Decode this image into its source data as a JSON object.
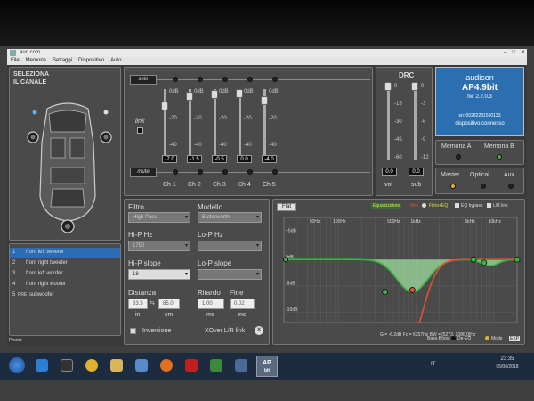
{
  "window": {
    "title": "aud.com"
  },
  "menu": [
    "File",
    "Memorie",
    "Settaggi",
    "Dispositivo",
    "Auto"
  ],
  "left": {
    "title_line1": "SELEZIONA",
    "title_line2": "IL CANALE",
    "channels": [
      {
        "num": "1",
        "name": "front left tweeter"
      },
      {
        "num": "2",
        "name": "front right tweeter"
      },
      {
        "num": "3",
        "name": "front left woofer"
      },
      {
        "num": "4",
        "name": "front right woofer"
      },
      {
        "num": "5",
        "name": "subwoofer",
        "tag": "PRE"
      }
    ],
    "status": "Pronto"
  },
  "mixer": {
    "solo_label": "solo",
    "link_label": "link",
    "mute_label": "mute",
    "scale": [
      "0dB",
      "-20",
      "-40"
    ],
    "channels": [
      {
        "label": "Ch 1",
        "value": "-7.0",
        "level": -7.0
      },
      {
        "label": "Ch 2",
        "value": "-1.5",
        "level": -1.5
      },
      {
        "label": "Ch 3",
        "value": "-0.5",
        "level": -0.5
      },
      {
        "label": "Ch 4",
        "value": "0.0",
        "level": 0.0
      },
      {
        "label": "Ch 5",
        "value": "-4.0",
        "level": -4.0
      }
    ]
  },
  "drc": {
    "title": "DRC",
    "vol_scale": [
      "0",
      "-15",
      "-30",
      "-45",
      "-60"
    ],
    "sub_scale": [
      "0",
      "-3",
      "-6",
      "-9",
      "-12"
    ],
    "vol_value": "0.0",
    "sub_value": "0.0",
    "vol_label": "vol",
    "sub_label": "sub"
  },
  "device": {
    "brand": "audison",
    "model": "AP4.9bit",
    "fw": "fw: 2.2.0.3",
    "sn": "sn: 00282281500133",
    "status": "dispositivo connesso",
    "memA": "Memoria A",
    "memB": "Memoria B",
    "master": "Master",
    "optical": "Optical",
    "aux": "Aux"
  },
  "filter": {
    "filtro_label": "Filtro",
    "filtro_value": "High Pass",
    "modello_label": "Modello",
    "modello_value": "Butterworth",
    "hp_hz_label": "Hi-P Hz",
    "hp_hz_value": "1750",
    "lp_hz_label": "Lo-P Hz",
    "hp_slope_label": "Hi-P slope",
    "hp_slope_value": "18",
    "lp_slope_label": "Lo-P slope",
    "distanza_label": "Distanza",
    "dist_in": "33.5",
    "dist_cm": "85.0",
    "in_label": "in",
    "cm_label": "cm",
    "ritardo_label": "Ritardo",
    "ritardo_value": "1.00",
    "ms_label": "ms",
    "fine_label": "Fine",
    "fine_value": "0.02",
    "ms2_label": "ms",
    "inversione_label": "Inversione",
    "xover_label": "XOver L/R link"
  },
  "eq": {
    "flat_btn": "Flat",
    "equalizzatore": "Equalizzatore",
    "filtro": "Filtro",
    "filtro_eq": "Filtro+EQ",
    "bypass": "EQ bypass",
    "lr_link": "L/R link",
    "freq_ticks": [
      "50Hz",
      "100Hz",
      "500Hz",
      "1kHz",
      "5kHz",
      "10kHz"
    ],
    "db_ticks": [
      "+5dB",
      "0dB",
      "-5dB",
      "-10dB"
    ],
    "readout": "G = -6.2dB    Fc = 6257Hz    BW = [5273, 2086.0]Hz",
    "bass_boost": "Bass-Boost",
    "de_eq": "De-EQ",
    "mode": "Mode",
    "exp": "EXP",
    "colors": {
      "eq_line": "#3cb043",
      "filter_line": "#e05030",
      "fill": "#9fdf9f"
    }
  },
  "taskbar": {
    "lang": "IT",
    "time": "23:35",
    "date": "05/06/2018",
    "active_app_line1": "AP",
    "active_app_line2": "bit"
  }
}
